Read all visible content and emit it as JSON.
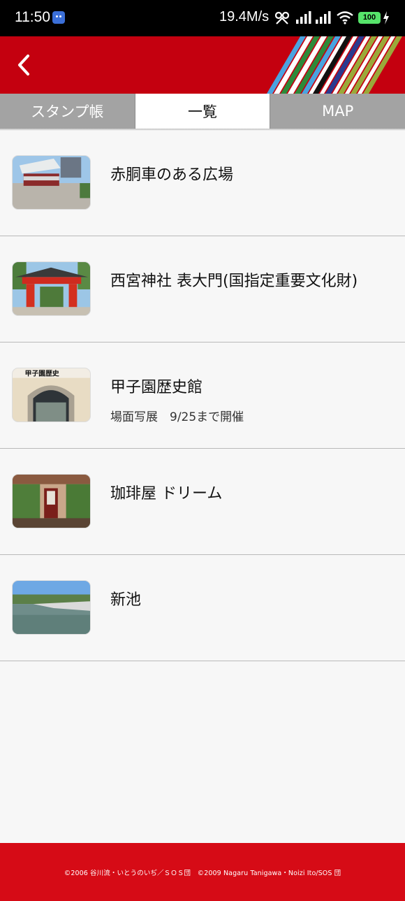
{
  "status_bar": {
    "time": "11:50",
    "network_speed": "19.4M/s",
    "battery": "100",
    "icons": [
      "notification-app-icon",
      "sync-icon",
      "signal-icon",
      "signal-icon",
      "wifi-icon",
      "battery-icon",
      "charging-icon"
    ]
  },
  "header": {
    "back_icon": "chevron-left-icon",
    "brand_color": "#c4000f"
  },
  "tabs": [
    {
      "label": "スタンプ帳",
      "active": false
    },
    {
      "label": "一覧",
      "active": true
    },
    {
      "label": "MAP",
      "active": false
    }
  ],
  "spots": [
    {
      "title": "赤胴車のある広場",
      "subtitle": ""
    },
    {
      "title": "西宮神社 表大門(国指定重要文化財)",
      "subtitle": ""
    },
    {
      "title": "甲子園歴史館",
      "subtitle": "場面写展　9/25まで開催",
      "thumb_sign": "甲子園歴史"
    },
    {
      "title": "珈琲屋 ドリーム",
      "subtitle": ""
    },
    {
      "title": "新池",
      "subtitle": ""
    }
  ],
  "footer": {
    "copyright": "©2006 谷川流・いとうのいぢ／ＳＯＳ団　©2009 Nagaru Tanigawa・Noizi Ito/SOS 団",
    "color": "#d60b16"
  }
}
